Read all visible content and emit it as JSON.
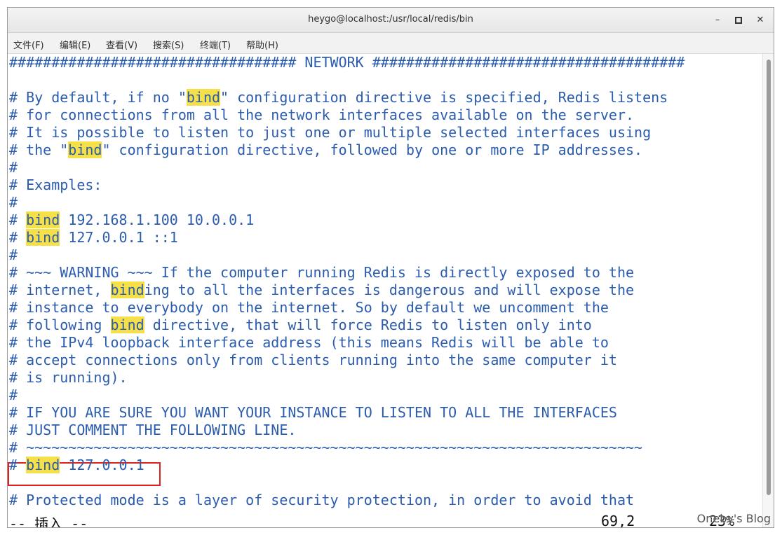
{
  "window": {
    "title": "heygo@localhost:/usr/local/redis/bin",
    "controls": {
      "minimize": "–",
      "maximize": "▫",
      "close": "✕"
    }
  },
  "menu": [
    "文件(F)",
    "编辑(E)",
    "查看(V)",
    "搜索(S)",
    "终端(T)",
    "帮助(H)"
  ],
  "terminal": {
    "lines": [
      "################################## NETWORK #####################################",
      "",
      "# By default, if no \"bind\" configuration directive is specified, Redis listens",
      "# for connections from all the network interfaces available on the server.",
      "# It is possible to listen to just one or multiple selected interfaces using",
      "# the \"bind\" configuration directive, followed by one or more IP addresses.",
      "#",
      "# Examples:",
      "#",
      "# bind 192.168.1.100 10.0.0.1",
      "# bind 127.0.0.1 ::1",
      "#",
      "# ~~~ WARNING ~~~ If the computer running Redis is directly exposed to the",
      "# internet, binding to all the interfaces is dangerous and will expose the",
      "# instance to everybody on the internet. So by default we uncomment the",
      "# following bind directive, that will force Redis to listen only into",
      "# the IPv4 loopback interface address (this means Redis will be able to",
      "# accept connections only from clients running into the same computer it",
      "# is running).",
      "#",
      "# IF YOU ARE SURE YOU WANT YOUR INSTANCE TO LISTEN TO ALL THE INTERFACES",
      "# JUST COMMENT THE FOLLOWING LINE.",
      "# ~~~~~~~~~~~~~~~~~~~~~~~~~~~~~~~~~~~~~~~~~~~~~~~~~~~~~~~~~~~~~~~~~~~~~~~~~",
      "# bind 127.0.0.1",
      "",
      "# Protected mode is a layer of security protection, in order to avoid that"
    ],
    "search_highlight": "bind",
    "highlight_color": "#f5e04a",
    "text_color": "#2b5cae"
  },
  "statusbar": {
    "mode": "-- 插入 --",
    "cursor_position": "69,2",
    "scroll_percent": "23%"
  },
  "watermark": "Oneby's Blog",
  "annotation_box_color": "#e02020"
}
